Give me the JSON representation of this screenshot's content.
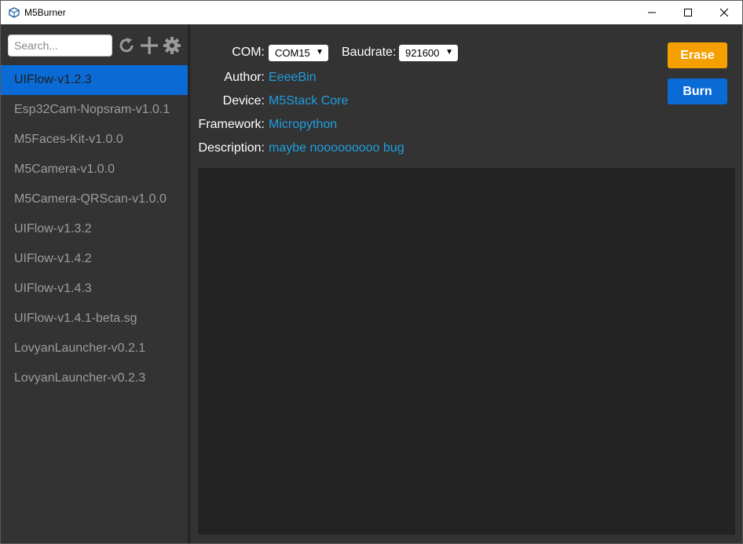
{
  "window": {
    "title": "M5Burner"
  },
  "sidebar": {
    "search_placeholder": "Search...",
    "items": [
      {
        "label": "UIFlow-v1.2.3"
      },
      {
        "label": "Esp32Cam-Nopsram-v1.0.1"
      },
      {
        "label": "M5Faces-Kit-v1.0.0"
      },
      {
        "label": "M5Camera-v1.0.0"
      },
      {
        "label": "M5Camera-QRScan-v1.0.0"
      },
      {
        "label": "UIFlow-v1.3.2"
      },
      {
        "label": "UIFlow-v1.4.2"
      },
      {
        "label": "UIFlow-v1.4.3"
      },
      {
        "label": "UIFlow-v1.4.1-beta.sg"
      },
      {
        "label": "LovyanLauncher-v0.2.1"
      },
      {
        "label": "LovyanLauncher-v0.2.3"
      }
    ],
    "selected_index": 0
  },
  "main": {
    "com_label": "COM:",
    "com_value": "COM15",
    "baud_label": "Baudrate:",
    "baud_value": "921600",
    "author_label": "Author:",
    "author_value": "EeeeBin",
    "device_label": "Device:",
    "device_value": "M5Stack Core",
    "framework_label": "Framework:",
    "framework_value": "Micropython",
    "description_label": "Description:",
    "description_value": "maybe nooooooooo bug",
    "erase_label": "Erase",
    "burn_label": "Burn"
  },
  "colors": {
    "accent_blue": "#0a6bd6",
    "erase_orange": "#f5a000",
    "link_blue": "#1e9fdf"
  }
}
